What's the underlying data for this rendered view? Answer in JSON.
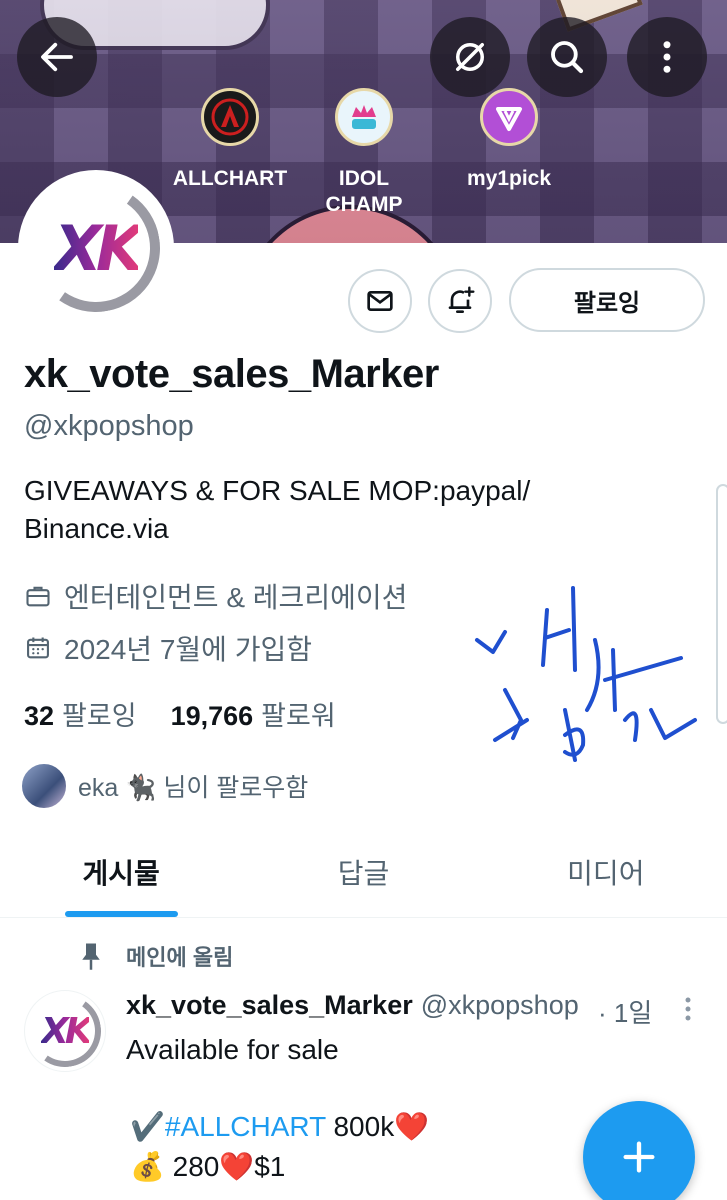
{
  "banner": {
    "back_label": "back",
    "badges": [
      {
        "label": "ALLCHART",
        "color": "#cc1f1f"
      },
      {
        "label": "IDOL CHAMP",
        "color": "#3ab8d6"
      },
      {
        "label": "my1pick",
        "color": "#a13ec7"
      }
    ]
  },
  "profile": {
    "display_name": "xk_vote_sales_Marker",
    "handle": "@xkpopshop",
    "follow_button": "팔로잉",
    "bio": "GIVEAWAYS & FOR SALE MOP:paypal/ Binance.via",
    "category": "엔터테인먼트 & 레크리에이션",
    "joined": "2024년 7월에 가입함",
    "following_count": "32",
    "following_label": "팔로잉",
    "followers_count": "19,766",
    "followers_label": "팔로워",
    "followed_by": "eka 🐈‍⬛ 님이 팔로우함"
  },
  "tabs": [
    {
      "label": "게시물",
      "active": true
    },
    {
      "label": "답글",
      "active": false
    },
    {
      "label": "미디어",
      "active": false
    }
  ],
  "post": {
    "pinned_label": "메인에 올림",
    "name": "xk_vote_sales_Marker",
    "handle": "@xkpopshop",
    "time": "· 1일",
    "text": "Available for sale",
    "line2_prefix": "✔️",
    "hashtag": "#ALLCHART",
    "line2_suffix": " 800k❤️",
    "line3": "💰 280❤️$1"
  },
  "colors": {
    "accent": "#1d9bf0",
    "secondary_text": "#536471",
    "signature_ink": "#1f4fcf"
  }
}
